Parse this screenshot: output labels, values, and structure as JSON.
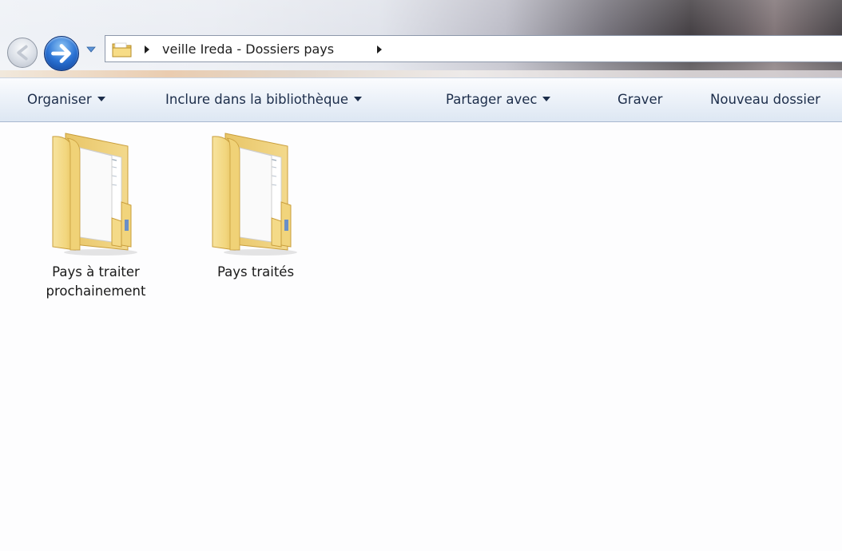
{
  "navigation": {
    "back_icon": "back-arrow-icon",
    "forward_icon": "forward-arrow-icon",
    "history_icon": "chevron-down-icon"
  },
  "address_bar": {
    "folder_icon": "folder-icon",
    "path": "veille Ireda - Dossiers pays"
  },
  "commandbar": {
    "organize_label": "Organiser",
    "include_label": "Inclure dans la bibliothèque",
    "share_label": "Partager avec",
    "burn_label": "Graver",
    "new_folder_label": "Nouveau dossier"
  },
  "files": [
    {
      "line1": "Pays à traiter",
      "line2": "prochainement",
      "icon": "folder-icon"
    },
    {
      "line1": "Pays traités",
      "line2": "",
      "icon": "folder-icon"
    }
  ],
  "colors": {
    "commandbar_text": "#1c2d4a",
    "folder_yellow": "#f4d77a",
    "forward_blue": "#2b73d4"
  }
}
